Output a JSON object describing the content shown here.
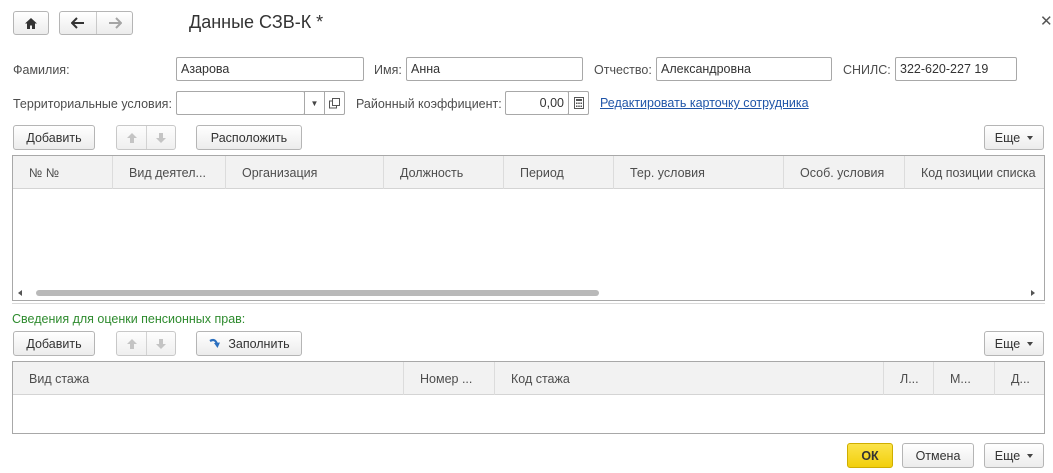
{
  "window": {
    "title": "Данные СЗВ-К *"
  },
  "fields": {
    "surname_label": "Фамилия:",
    "surname": "Азарова",
    "name_label": "Имя:",
    "name": "Анна",
    "patronymic_label": "Отчество:",
    "patronymic": "Александровна",
    "snils_label": "СНИЛС:",
    "snils": "322-620-227 19",
    "territory_label": "Территориальные условия:",
    "territory": "",
    "coef_label": "Районный коэффициент:",
    "coef": "0,00",
    "edit_link": "Редактировать карточку сотрудника"
  },
  "toolbar1": {
    "add": "Добавить",
    "arrange": "Расположить",
    "more": "Еще"
  },
  "table1": {
    "columns": [
      "№ №",
      "Вид деятел...",
      "Организация",
      "Должность",
      "Период",
      "Тер. условия",
      "Особ. условия",
      "Код позиции списка"
    ]
  },
  "pension_section": {
    "title": "Сведения для оценки пенсионных прав:"
  },
  "toolbar2": {
    "add": "Добавить",
    "fill": "Заполнить",
    "more": "Еще"
  },
  "table2": {
    "columns": [
      "Вид стажа",
      "Номер ...",
      "Код стажа",
      "Л...",
      "М...",
      "Д..."
    ]
  },
  "footer": {
    "ok": "ОК",
    "cancel": "Отмена",
    "more": "Еще"
  },
  "colors": {
    "accent_yellow": "#f5d312",
    "link": "#1f55a8",
    "section_green": "#2e8b2e"
  }
}
